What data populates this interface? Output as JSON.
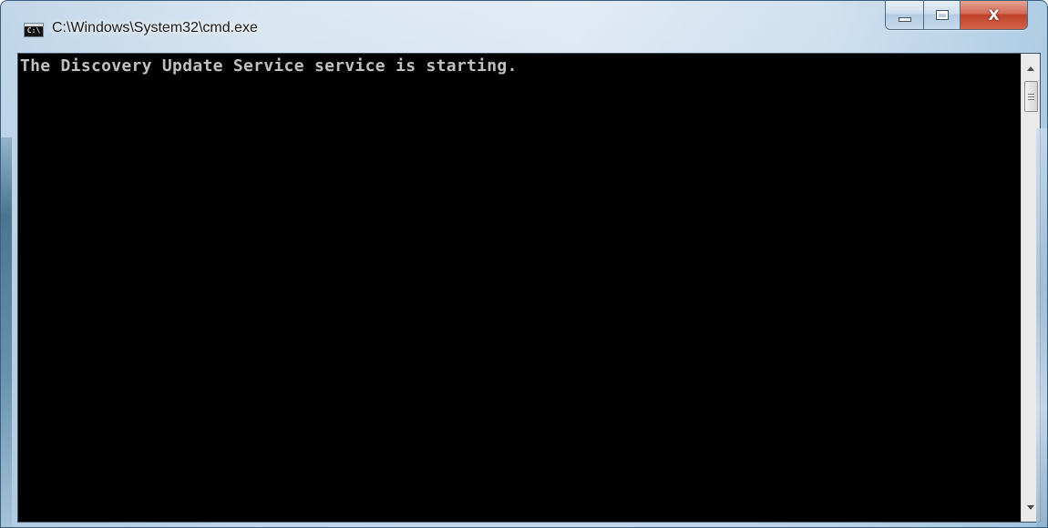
{
  "window": {
    "title": "C:\\Windows\\System32\\cmd.exe",
    "icon_text": "C:\\",
    "icon": "console-app-icon",
    "caption_buttons": {
      "minimize_icon": "minimize-icon",
      "maximize_icon": "maximize-icon",
      "close_icon": "close-icon",
      "close_glyph": "X"
    }
  },
  "console": {
    "lines": [
      "The Discovery Update Service service is starting."
    ],
    "colors": {
      "background": "#000000",
      "foreground": "#c0c0c0"
    }
  },
  "scrollbar": {
    "up_icon": "scroll-up-arrow-icon",
    "down_icon": "scroll-down-arrow-icon"
  }
}
